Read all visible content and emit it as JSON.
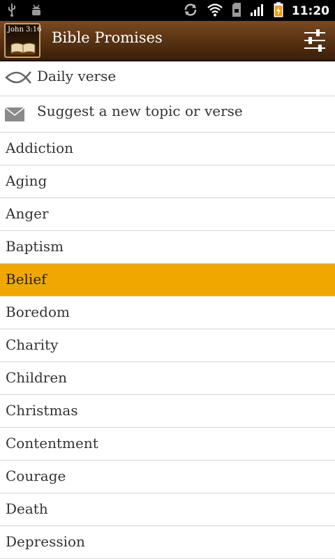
{
  "status_bar": {
    "time": "11:20",
    "icons": [
      "usb-icon",
      "android-debug-icon",
      "sync-icon",
      "wifi-icon",
      "sd-card-icon",
      "signal-icon",
      "battery-charging-icon"
    ]
  },
  "header": {
    "app_icon_text": "John 3:16",
    "title": "Bible Promises"
  },
  "special_items": [
    {
      "label": "Daily verse",
      "icon": "fish-icon"
    },
    {
      "label": "Suggest a new topic or verse",
      "icon": "envelope-icon"
    }
  ],
  "topics": [
    {
      "label": "Addiction"
    },
    {
      "label": "Aging"
    },
    {
      "label": "Anger"
    },
    {
      "label": "Baptism"
    },
    {
      "label": "Belief",
      "selected": true
    },
    {
      "label": "Boredom"
    },
    {
      "label": "Charity"
    },
    {
      "label": "Children"
    },
    {
      "label": "Christmas"
    },
    {
      "label": "Contentment"
    },
    {
      "label": "Courage"
    },
    {
      "label": "Death"
    },
    {
      "label": "Depression"
    }
  ],
  "colors": {
    "selected_row": "#f0a800",
    "titlebar": "#5e3716"
  }
}
